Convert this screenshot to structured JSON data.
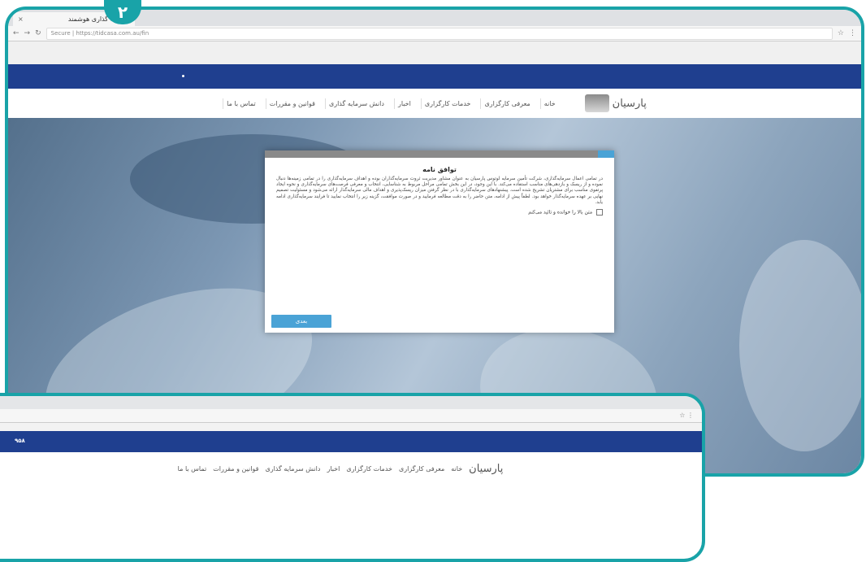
{
  "badge": {
    "number": "۲"
  },
  "browser": {
    "tab_title": "سرمایه گذاری هوشمند",
    "tab_close": "×",
    "url": "Secure | https://tidcasa.com.au/fin",
    "back_addr_icons": "☆ ⋮"
  },
  "site": {
    "logo_text": "پارسیان",
    "nav_items": [
      "خانه",
      "معرفی کارگزاری",
      "خدمات کارگزاری",
      "اخبار",
      "دانش سرمایه گذاری",
      "قوانین و مقررات",
      "تماس با ما"
    ]
  },
  "modal": {
    "title": "توافق نامه",
    "body": "در تمامی اعمال سرمایه‌گذاری، شرکت تأمین سرمایه لوتوس پارسیان به عنوان مشاور مدیریت ثروت سرمایه‌گذاران بوده و اهداف سرمایه‌گذاری را در تمامی زمینه‌ها دنبال نموده و از ریسک و بازدهی‌های مناسب استفاده می‌کند. با این وجود، در این بخش تمامی مراحل مربوط به شناسایی، انتخاب و معرفی فرصت‌های سرمایه‌گذاری و نحوه ایجاد پرتفوی مناسب برای مشتریان تشریح شده است. پیشنهادهای سرمایه‌گذاری با در نظر گرفتن میزان ریسک‌پذیری و اهداف مالی سرمایه‌گذار ارائه می‌شود و مسئولیت تصمیم نهایی بر عهده سرمایه‌گذار خواهد بود. لطفاً پیش از ادامه، متن حاضر را به دقت مطالعه فرمایید و در صورت موافقت، گزینه زیر را انتخاب نمایید تا فرایند سرمایه‌گذاری ادامه یابد.",
    "agree_label": "متن بالا را خوانده و تائید می‌کنم",
    "next_button": "بعدی"
  },
  "back_window": {
    "topbar_label": "۹۵۸"
  }
}
